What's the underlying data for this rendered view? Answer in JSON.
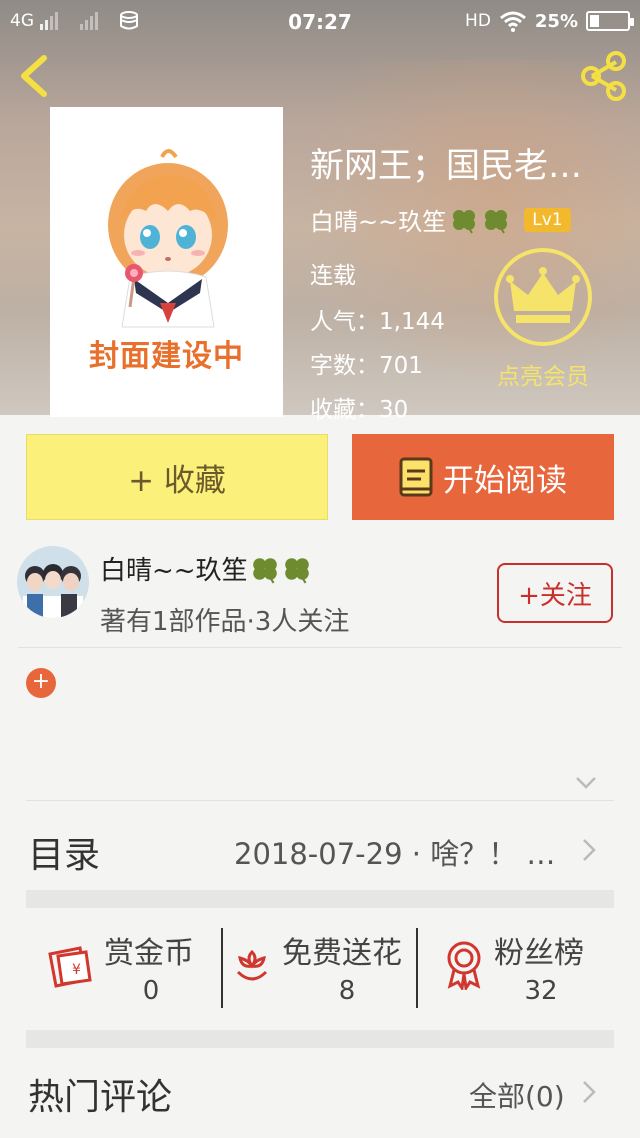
{
  "status_bar": {
    "network": "4G",
    "time": "07:27",
    "hd": "HD",
    "battery": "25%",
    "battery_level": 0.25
  },
  "book": {
    "title": "新网王；国民老…",
    "author": "白晴~~玖笙",
    "level": "Lv1",
    "status": "连载",
    "popularity_label": "人气：",
    "popularity": "1,144",
    "words_label": "字数：",
    "words": "701",
    "favorites_label": "收藏：",
    "favorites": "30",
    "cover_text": "封面建设中",
    "vip_label": "点亮会员"
  },
  "actions": {
    "collect_label": "+ 收藏",
    "read_label": "开始阅读"
  },
  "author": {
    "name": "白晴~~玖笙",
    "subtitle": "著有1部作品·3人关注",
    "follow_label": "+关注"
  },
  "intro": {
    "add_icon": "plus-icon"
  },
  "catalog": {
    "label": "目录",
    "latest": "2018-07-29 · 啥？！ 穿…"
  },
  "stats": [
    {
      "label": "赏金币",
      "value": "0",
      "icon": "red-envelope-icon"
    },
    {
      "label": "免费送花",
      "value": "8",
      "icon": "flower-icon"
    },
    {
      "label": "粉丝榜",
      "value": "32",
      "icon": "medal-icon"
    }
  ],
  "comments": {
    "label": "热门评论",
    "all_label": "全部(0)"
  },
  "colors": {
    "accent_orange": "#e8663c",
    "collect_yellow": "#fbf07a",
    "follow_red": "#c9302c",
    "level_badge": "#f2b92e",
    "vip_gold": "#f5e36a"
  }
}
